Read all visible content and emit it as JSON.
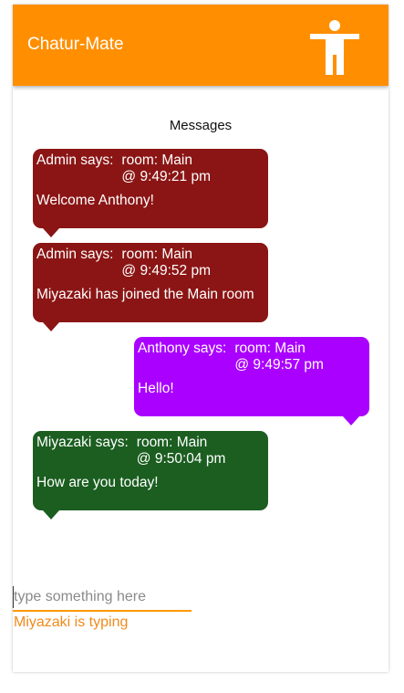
{
  "app": {
    "title": "Chatur-Mate",
    "accent_color": "#ff8f00",
    "profile_icon": "person-standing-icon"
  },
  "messages_heading": "Messages",
  "messages": [
    {
      "sender": "Admin says:",
      "room": "room: Main",
      "time": "@ 9:49:21 pm",
      "text": "Welcome Anthony!",
      "color": "#8b1515",
      "align": "left"
    },
    {
      "sender": "Admin says:",
      "room": "room: Main",
      "time": "@ 9:49:52 pm",
      "text": "Miyazaki has joined the Main room",
      "color": "#8b1515",
      "align": "left"
    },
    {
      "sender": "Anthony says:",
      "room": "room: Main",
      "time": "@ 9:49:57 pm",
      "text": "Hello!",
      "color": "#aa00ff",
      "align": "right"
    },
    {
      "sender": "Miyazaki says:",
      "room": "room: Main",
      "time": "@ 9:50:04 pm",
      "text": "How are you today!",
      "color": "#1b5e20",
      "align": "left"
    }
  ],
  "composer": {
    "value": "",
    "placeholder": "type something here",
    "typing_status": "Miyazaki is typing"
  }
}
